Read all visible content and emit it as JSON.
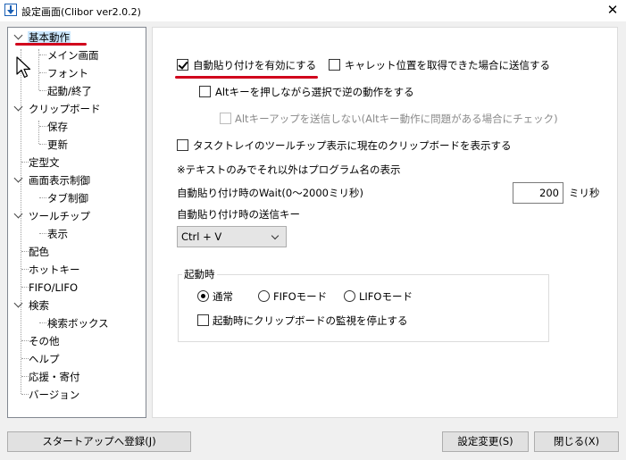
{
  "window": {
    "title": "設定画面(Clibor ver2.0.2)",
    "close_glyph": "✕"
  },
  "tree": {
    "items": [
      {
        "label": "基本動作",
        "selected": true
      },
      {
        "label": "メイン画面"
      },
      {
        "label": "フォント"
      },
      {
        "label": "起動/終了"
      },
      {
        "label": "クリップボード"
      },
      {
        "label": "保存"
      },
      {
        "label": "更新"
      },
      {
        "label": "定型文"
      },
      {
        "label": "画面表示制御"
      },
      {
        "label": "タブ制御"
      },
      {
        "label": "ツールチップ"
      },
      {
        "label": "表示"
      },
      {
        "label": "配色"
      },
      {
        "label": "ホットキー"
      },
      {
        "label": "FIFO/LIFO"
      },
      {
        "label": "検索"
      },
      {
        "label": "検索ボックス"
      },
      {
        "label": "その他"
      },
      {
        "label": "ヘルプ"
      },
      {
        "label": "応援・寄付"
      },
      {
        "label": "バージョン"
      }
    ]
  },
  "settings": {
    "auto_paste": {
      "label": "自動貼り付けを有効にする",
      "checked": true
    },
    "caret_send": {
      "label": "キャレット位置を取得できた場合に送信する",
      "checked": false
    },
    "alt_reverse": {
      "label": "Altキーを押しながら選択で逆の動作をする",
      "checked": false
    },
    "alt_up": {
      "label": "Altキーアップを送信しない(Altキー動作に問題がある場合にチェック)",
      "checked": false,
      "disabled": true
    },
    "tray_tooltip": {
      "label": "タスクトレイのツールチップ表示に現在のクリップボードを表示する",
      "checked": false
    },
    "note": "※テキストのみでそれ以外はプログラム名の表示",
    "wait_label": "自動貼り付け時のWait(0～2000ミリ秒)",
    "wait_value": "200",
    "wait_unit": "ミリ秒",
    "send_key_label": "自動貼り付け時の送信キー",
    "send_key_value": "Ctrl + V"
  },
  "startup_group": {
    "label": "起動時",
    "modes": [
      {
        "label": "通常",
        "checked": true
      },
      {
        "label": "FIFOモード",
        "checked": false
      },
      {
        "label": "LIFOモード",
        "checked": false
      }
    ],
    "stop_monitor": {
      "label": "起動時にクリップボードの監視を停止する",
      "checked": false
    }
  },
  "buttons": {
    "startup_register": "スタートアップへ登録(J)",
    "apply": "設定変更(S)",
    "close": "閉じる(X)"
  },
  "colors": {
    "annotation_red": "#d1001c",
    "selection": "#cce8ff"
  }
}
